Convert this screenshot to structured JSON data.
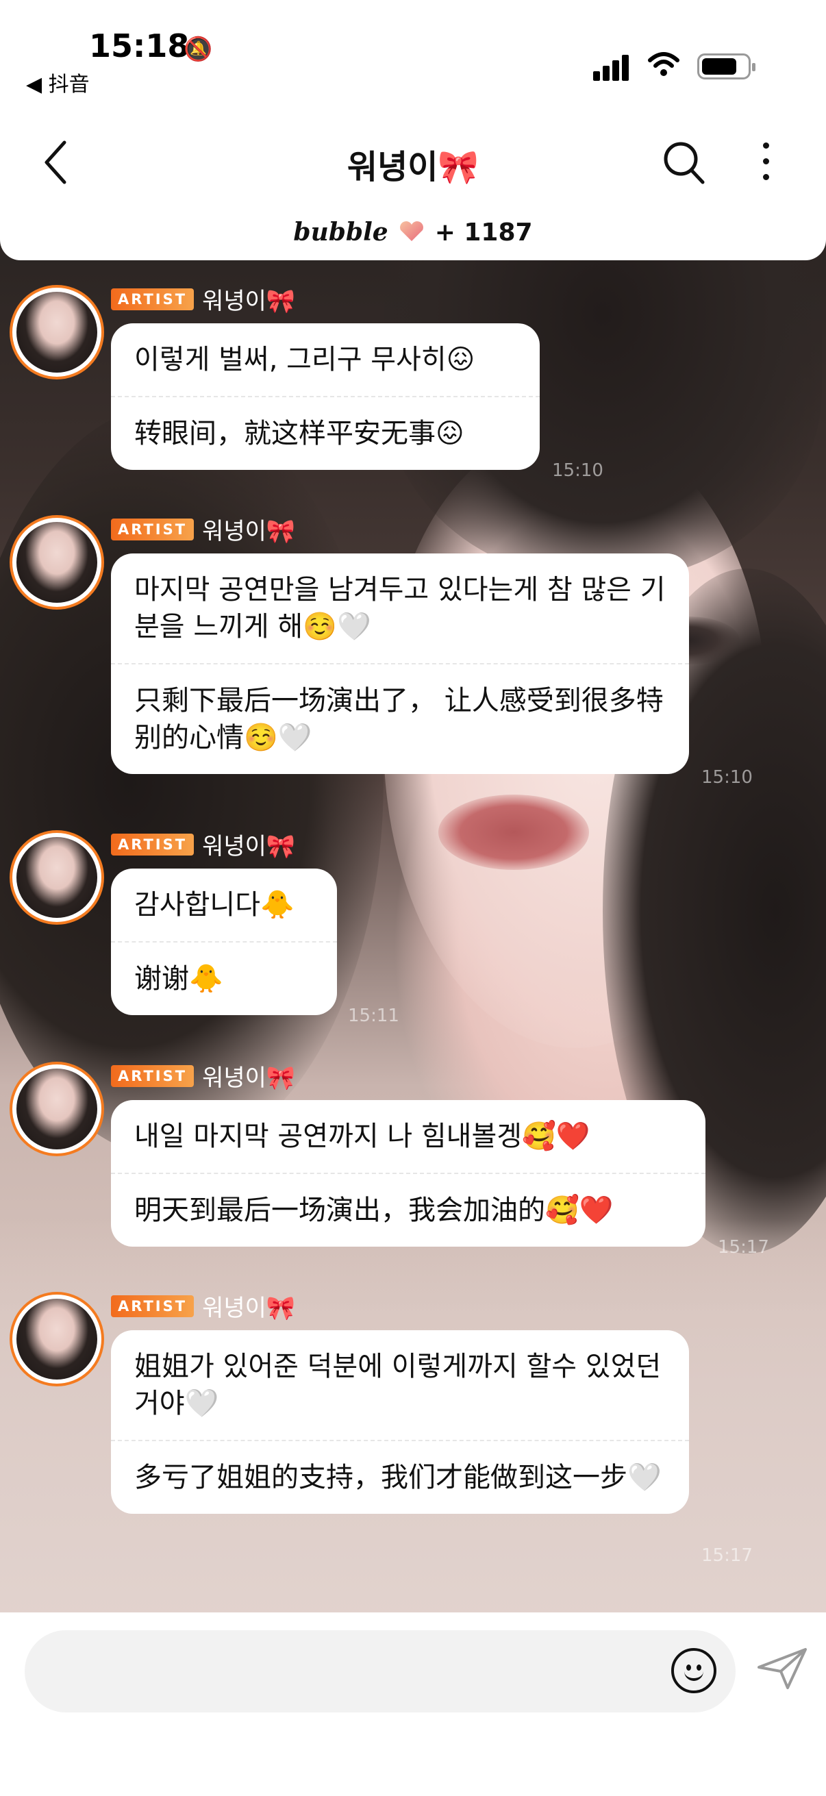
{
  "status_bar": {
    "time": "15:18",
    "back_app": "◀ 抖音"
  },
  "header": {
    "title": "워녕이🎀",
    "brand": "bubble",
    "count_text": "+ 1187"
  },
  "messages": [
    {
      "badge": "ARTIST",
      "sender": "워녕이🎀",
      "lines": [
        "이렇게 벌써, 그리구 무사히😖",
        "转眼间，就这样平安无事😖"
      ],
      "time": "15:10"
    },
    {
      "badge": "ARTIST",
      "sender": "워녕이🎀",
      "lines": [
        "마지막 공연만을 남겨두고 있다는게 참 많은 기분을 느끼게 해☺️🤍",
        "只剩下最后一场演出了， 让人感受到很多特别的心情☺️🤍"
      ],
      "time": "15:10"
    },
    {
      "badge": "ARTIST",
      "sender": "워녕이🎀",
      "lines": [
        "감사합니다🐥",
        "谢谢🐥"
      ],
      "time": "15:11"
    },
    {
      "badge": "ARTIST",
      "sender": "워녕이🎀",
      "lines": [
        "내일 마지막 공연까지 나 힘내볼겡🥰❤️",
        "明天到最后一场演出，我会加油的🥰❤️"
      ],
      "time": "15:17"
    },
    {
      "badge": "ARTIST",
      "sender": "워녕이🎀",
      "lines": [
        "姐姐가 있어준 덕분에 이렇게까지 할수 있었던거야🤍",
        "多亏了姐姐的支持，我们才能做到这一步🤍"
      ],
      "time": "15:17"
    }
  ],
  "colors": {
    "accent": "#f47b20",
    "bubble_bg": "#ffffff"
  },
  "icons": {
    "back": "chevron-left-icon",
    "search": "search-icon",
    "more": "more-vertical-icon",
    "emoji": "emoji-icon",
    "send": "send-icon"
  }
}
